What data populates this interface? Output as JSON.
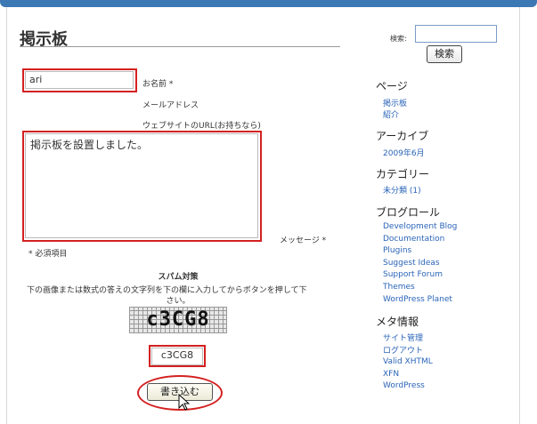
{
  "page_title": "掲示板",
  "form": {
    "name_value": "ari",
    "name_label": "お名前 *",
    "email_label": "メールアドレス",
    "url_label": "ウェブサイトのURL(お持ちなら)",
    "message_value": "掲示板を設置しました。",
    "message_label": "メッセージ *",
    "required_note": "* 必須項目",
    "spam_heading": "スパム対策",
    "spam_instructions_line1": "下の画像または数式の答えの文字列を下の欄に入力してからボタンを押して下",
    "spam_instructions_line2": "さい。",
    "captcha_image_text": "c3CG8",
    "captcha_value": "c3CG8",
    "submit_label": "書き込む"
  },
  "sidebar": {
    "search_label": "検索:",
    "search_value": "",
    "search_button": "検索",
    "pages_heading": "ページ",
    "pages": [
      "掲示板",
      "紹介"
    ],
    "archives_heading": "アーカイブ",
    "archives": [
      "2009年6月"
    ],
    "categories_heading": "カテゴリー",
    "categories": [
      "未分類 (1)"
    ],
    "blogroll_heading": "ブログロール",
    "blogroll": [
      "Development Blog",
      "Documentation",
      "Plugins",
      "Suggest Ideas",
      "Support Forum",
      "Themes",
      "WordPress Planet"
    ],
    "meta_heading": "メタ情報",
    "meta": [
      "サイト管理",
      "ログアウト",
      "Valid XHTML",
      "XFN",
      "WordPress"
    ]
  },
  "colors": {
    "highlight": "#d42020",
    "link": "#2a64b8",
    "topbar": "#3c78b4"
  }
}
